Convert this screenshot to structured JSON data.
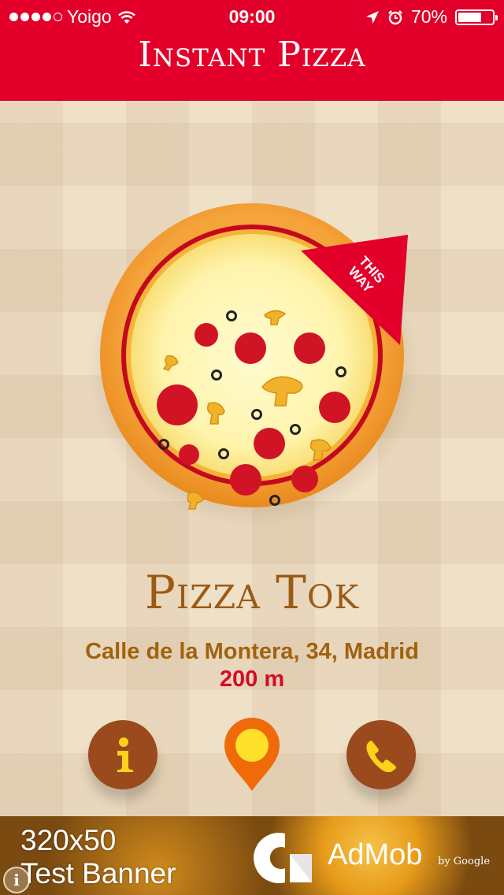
{
  "status_bar": {
    "carrier": "Yoigo",
    "time": "09:00",
    "battery": "70%",
    "battery_level": 0.7,
    "signal_bars": 4,
    "icons": [
      "wifi-icon",
      "location-arrow-icon",
      "alarm-icon",
      "battery-icon"
    ]
  },
  "header": {
    "title": "Instant Pizza"
  },
  "compass": {
    "pointer_text_line1": "THIS",
    "pointer_text_line2": "WAY"
  },
  "place": {
    "name": "Pizza Tok",
    "address": "Calle de la Montera, 34, Madrid",
    "distance": "200 m"
  },
  "actions": [
    {
      "name": "info",
      "icon": "info-icon"
    },
    {
      "name": "map",
      "icon": "map-pin-icon"
    },
    {
      "name": "call",
      "icon": "phone-icon"
    }
  ],
  "ad": {
    "line1": "320x50",
    "line2": "Test Banner",
    "brand": "AdMob",
    "by": "by Google",
    "info_glyph": "i"
  },
  "colors": {
    "brand_red": "#e2002a",
    "brown": "#9a4a1c",
    "name_brown": "#9c5a14",
    "distance_red": "#d40a2a",
    "pin_orange": "#f06a0a",
    "pin_yellow": "#ffe02a"
  }
}
